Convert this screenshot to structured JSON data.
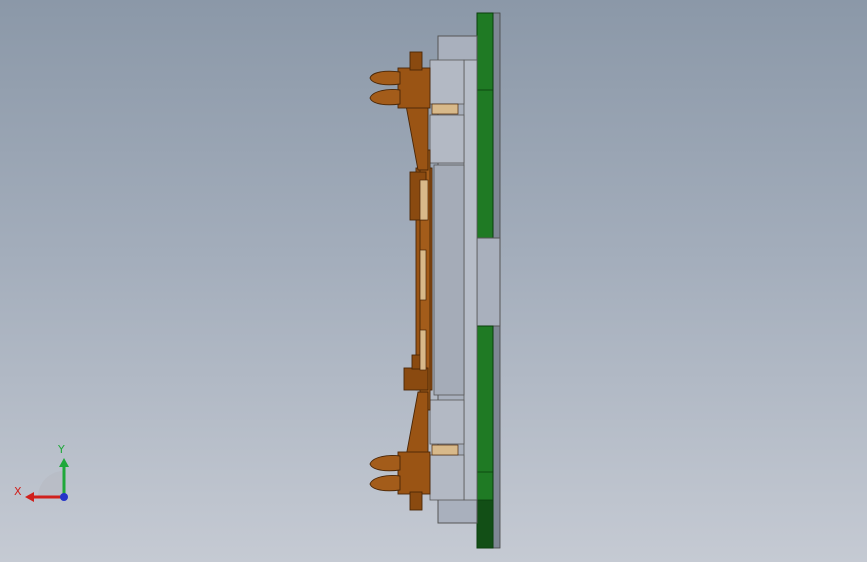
{
  "view": {
    "background_top": "#8b98a8",
    "background_bottom": "#c5cad3"
  },
  "model": {
    "colors": {
      "plate_green": "#1f7a24",
      "plate_green_dark": "#124f16",
      "block_gray": "#a9b0bd",
      "block_gray_dark": "#8d95a3",
      "clamp_brown": "#9a5414",
      "clamp_brown_dark": "#5e3008",
      "pin_tan": "#d8b98a"
    }
  },
  "triad": {
    "x_label": "X",
    "y_label": "Y",
    "x_color": "#d0201c",
    "y_color": "#1fa83a",
    "z_color": "#2434c8"
  }
}
